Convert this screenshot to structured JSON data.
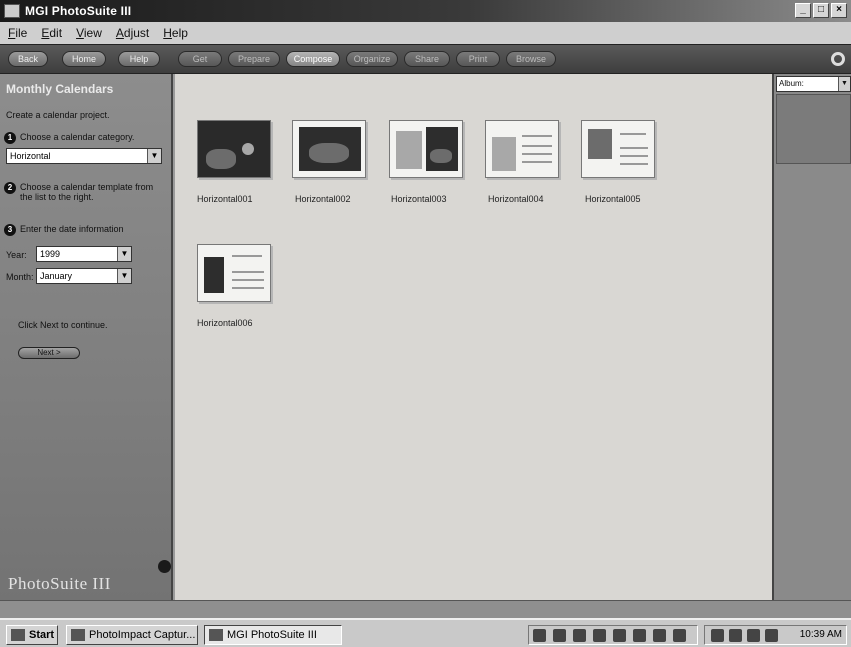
{
  "window": {
    "title": "MGI PhotoSuite III"
  },
  "menu": [
    "File",
    "Edit",
    "View",
    "Adjust",
    "Help"
  ],
  "nav": {
    "left": [
      "Back",
      "Home",
      "Help"
    ],
    "main": [
      "Get",
      "Prepare",
      "Compose",
      "Organize",
      "Share",
      "Print",
      "Browse"
    ]
  },
  "panel": {
    "title": "Monthly Calendars",
    "subtitle": "Create a calendar project.",
    "step1_label": "Choose a calendar category.",
    "category_value": "Horizontal",
    "step2_label": "Choose a calendar template from the list to the right.",
    "step3_label": "Enter the date information",
    "year_label": "Year:",
    "year_value": "1999",
    "month_label": "Month:",
    "month_value": "January",
    "continue_text": "Click Next to continue.",
    "next_label": "Next >",
    "brand": "PhotoSuite III"
  },
  "templates": [
    "Horizontal001",
    "Horizontal002",
    "Horizontal003",
    "Horizontal004",
    "Horizontal005",
    "Horizontal006"
  ],
  "album": {
    "selected": "Album:"
  },
  "taskbar": {
    "start": "Start",
    "tasks": [
      "PhotoImpact Captur...",
      "MGI PhotoSuite III"
    ],
    "clock": "10:39 AM"
  }
}
